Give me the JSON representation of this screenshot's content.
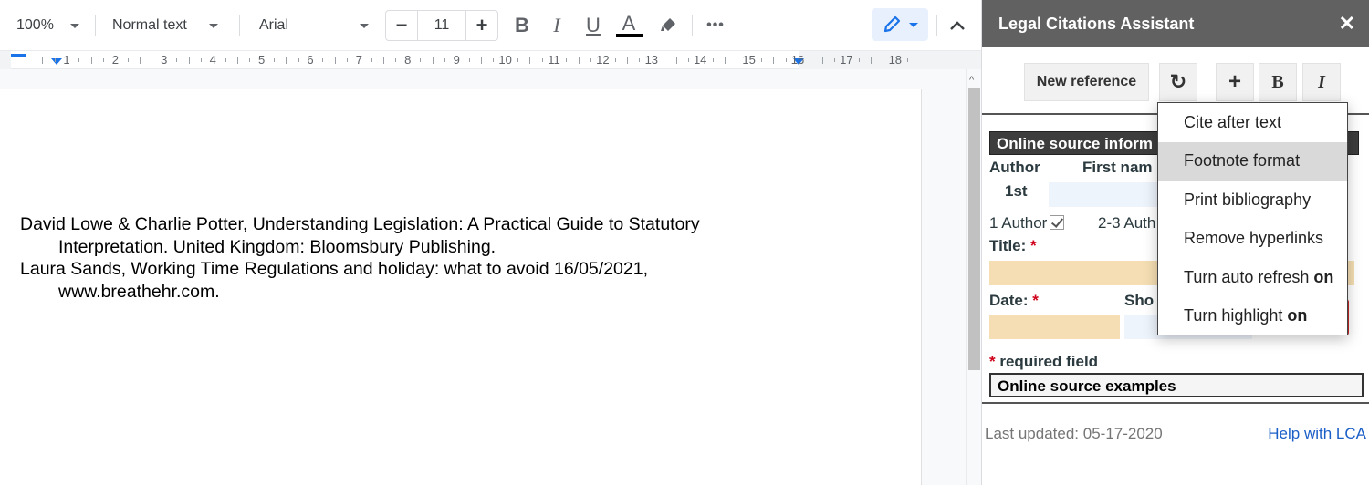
{
  "toolbar": {
    "zoom": "100%",
    "style": "Normal text",
    "font": "Arial",
    "font_size": "11",
    "decrease_size": "−",
    "increase_size": "+",
    "bold": "B",
    "italic": "I",
    "underline": "U",
    "text_color_glyph": "A",
    "text_color": "#000000",
    "more": "•••",
    "editing_mode_icon": "pencil-icon",
    "collapse_icon": "chevron-up-icon"
  },
  "ruler": {
    "numbers": [
      "1",
      "2",
      "3",
      "4",
      "5",
      "6",
      "7",
      "8",
      "9",
      "10",
      "11",
      "12",
      "13",
      "14",
      "15",
      "16",
      "17",
      "18"
    ]
  },
  "document": {
    "paragraphs": [
      {
        "line1": "David Lowe & Charlie Potter, Understanding Legislation: A Practical Guide to Statutory",
        "line2": "Interpretation. United Kingdom: Bloomsbury Publishing."
      },
      {
        "line1": "Laura Sands, Working Time Regulations and holiday: what to avoid 16/05/2021,",
        "line2": "www.breathehr.com."
      }
    ]
  },
  "sidebar": {
    "title": "Legal Citations Assistant",
    "close": "✕",
    "buttons": {
      "new_reference": "New reference",
      "refresh": "↻",
      "add": "+",
      "bold": "B",
      "italic": "I"
    },
    "form": {
      "section_title": "Online source inform",
      "author_label": "Author",
      "first_name_label": "First nam",
      "author_order": "1st",
      "one_author": "1 Author",
      "one_author_checked": true,
      "two_three_authors": "2-3 Auth",
      "title_label": "Title:",
      "date_label": "Date:",
      "short_title_label": "Sho",
      "required_marker": "*",
      "required_note": "required field",
      "examples": "Online source examples"
    },
    "menu": {
      "items": [
        {
          "label": "Cite after text",
          "suffix": ""
        },
        {
          "label": "Footnote format",
          "suffix": "",
          "highlighted": true
        },
        {
          "label": "Print bibliography",
          "suffix": ""
        },
        {
          "label": "Remove hyperlinks",
          "suffix": ""
        },
        {
          "label": "Turn auto refresh",
          "suffix": "on"
        },
        {
          "label": "Turn highlight",
          "suffix": "on"
        }
      ]
    },
    "footer": {
      "last_updated": "Last updated: 05-17-2020",
      "help_link": "Help with LCA"
    }
  },
  "colors": {
    "sidebar_header": "#616161",
    "required_field_fill": "#f5deb3",
    "optional_field_fill": "#eef4fc",
    "required_marker": "#d0021b",
    "link": "#1a5ec7",
    "accent": "#1a73e8"
  }
}
